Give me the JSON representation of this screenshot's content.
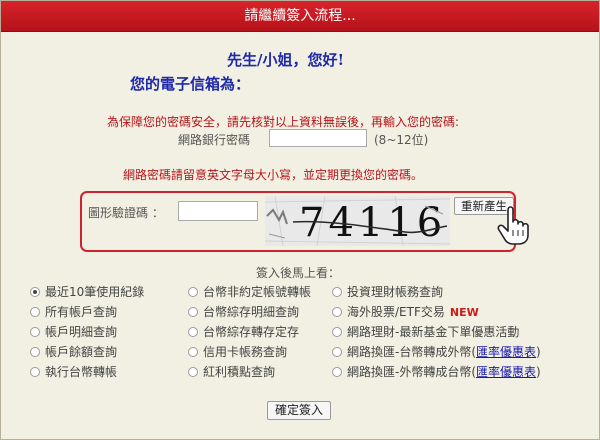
{
  "header": {
    "title": "請繼續簽入流程..."
  },
  "greeting": "先生/小姐，您好!",
  "email_label": "您的電子信箱為：",
  "security_warning": "為保障您的密碼安全，請先核對以上資料無誤後，再輸入您的密碼:",
  "password": {
    "label": "網路銀行密碼",
    "value": "",
    "hint": "(8~12位)"
  },
  "case_warning": "網路密碼請留意英文字母大小寫，並定期更換您的密碼。",
  "captcha": {
    "label": "圖形驗證碼 ：",
    "value": "",
    "image_text": "74116",
    "refresh_label": "重新產生"
  },
  "options": {
    "title": "簽入後馬上看：",
    "items": [
      {
        "label": "最近10筆使用紀錄",
        "checked": true
      },
      {
        "label": "所有帳戶查詢",
        "checked": false
      },
      {
        "label": "帳戶明細查詢",
        "checked": false
      },
      {
        "label": "帳戶餘額查詢",
        "checked": false
      },
      {
        "label": "執行台幣轉帳",
        "checked": false
      },
      {
        "label": "台幣非約定帳號轉帳",
        "checked": false
      },
      {
        "label": "台幣綜存明細查詢",
        "checked": false
      },
      {
        "label": "台幣綜存轉存定存",
        "checked": false
      },
      {
        "label": "信用卡帳務查詢",
        "checked": false
      },
      {
        "label": "紅利積點查詢",
        "checked": false
      },
      {
        "label": "投資理財帳務查詢",
        "checked": false
      },
      {
        "label": "海外股票/ETF交易",
        "checked": false,
        "badge": "NEW"
      },
      {
        "label": "網路理財-最新基金下單優惠活動",
        "checked": false
      },
      {
        "label": "網路換匯-台幣轉成外幣(",
        "checked": false,
        "link": "匯率優惠表",
        "suffix": ")"
      },
      {
        "label": "網路換匯-外幣轉成台幣(",
        "checked": false,
        "link": "匯率優惠表",
        "suffix": ")"
      }
    ]
  },
  "submit_label": "確定簽入",
  "colors": {
    "title_bar": "#c4161f",
    "warning": "#b8141b",
    "greeting": "#1f2aa8",
    "background": "#f1f0e2"
  }
}
